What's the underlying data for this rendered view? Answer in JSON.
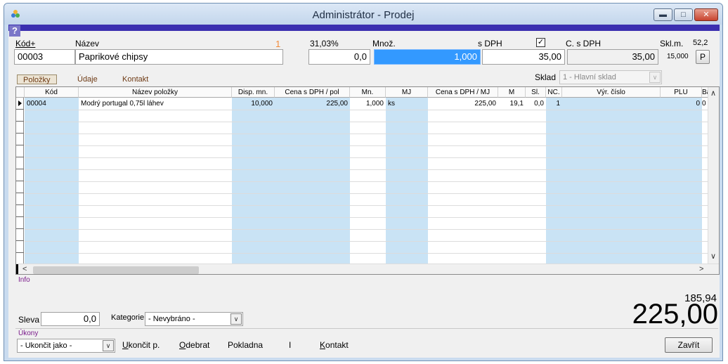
{
  "window": {
    "title": "Administrátor - Prodej"
  },
  "help": "?",
  "header": {
    "kod_label": "Kód+",
    "nazev_label": "Název",
    "kod_value": "00003",
    "nazev_value": "Paprikové chipsy",
    "counter": "1",
    "percent": "31,03%",
    "first_value": "0,0",
    "mnoz_label": "Množ.",
    "mnoz_value": "1,000",
    "sdph_label": "s DPH",
    "sdph_check": "✓",
    "sdph_value": "35,00",
    "csdph_label": "C. s DPH",
    "csdph_value": "35,00",
    "sklm_label": "Skl.m.",
    "sklm_value": "52,2",
    "sklm_sub": "15,000",
    "p_button": "P"
  },
  "tabs": [
    {
      "label": "Položky"
    },
    {
      "label": "Údaje"
    },
    {
      "label": "Kontakt"
    }
  ],
  "sklad": {
    "label": "Sklad",
    "value": "1 - Hlavní sklad"
  },
  "grid": {
    "columns": [
      "Kód",
      "Název položky",
      "Disp. mn.",
      "Cena s DPH / pol",
      "Mn.",
      "MJ",
      "Cena s DPH / MJ",
      "M",
      "Sl.",
      "NC.",
      "Výr. číslo",
      "PLU",
      "Ba"
    ],
    "rows": [
      [
        "00004",
        "Modrý portugal 0,75l láhev",
        "10,000",
        "225,00",
        "1,000",
        "ks",
        "225,00",
        "19,1",
        "0,0",
        "1",
        "",
        "0",
        "0"
      ]
    ]
  },
  "info": {
    "label": "Info",
    "sleva_label": "Sleva",
    "sleva_value": "0,0",
    "kategorie_label": "Kategorie",
    "kategorie_value": "- Nevybráno -",
    "subtotal": "185,94",
    "total": "225,00"
  },
  "ukony": {
    "label": "Úkony",
    "select_value": "- Ukončit jako -",
    "links": [
      "Ukončit p.",
      "Odebrat",
      "Pokladna",
      "I",
      "Kontakt"
    ],
    "close_button": "Zavřít"
  },
  "colors": {
    "accent_bar": "#3b2fb0",
    "selection": "#3399ff",
    "column_highlight": "#c9e3f5"
  }
}
